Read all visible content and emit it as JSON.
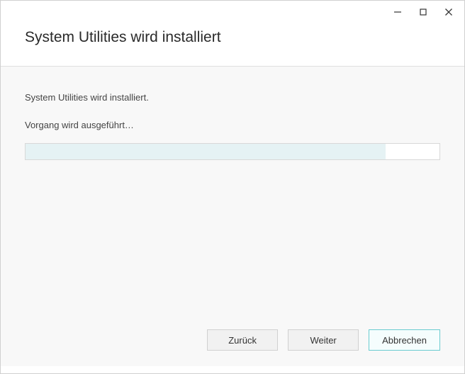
{
  "header": {
    "title": "System Utilities wird installiert"
  },
  "content": {
    "status_text": "System Utilities wird installiert.",
    "progress_label": "Vorgang wird ausgeführt…",
    "progress_percent": 87
  },
  "buttons": {
    "back": "Zurück",
    "next": "Weiter",
    "cancel": "Abbrechen"
  }
}
